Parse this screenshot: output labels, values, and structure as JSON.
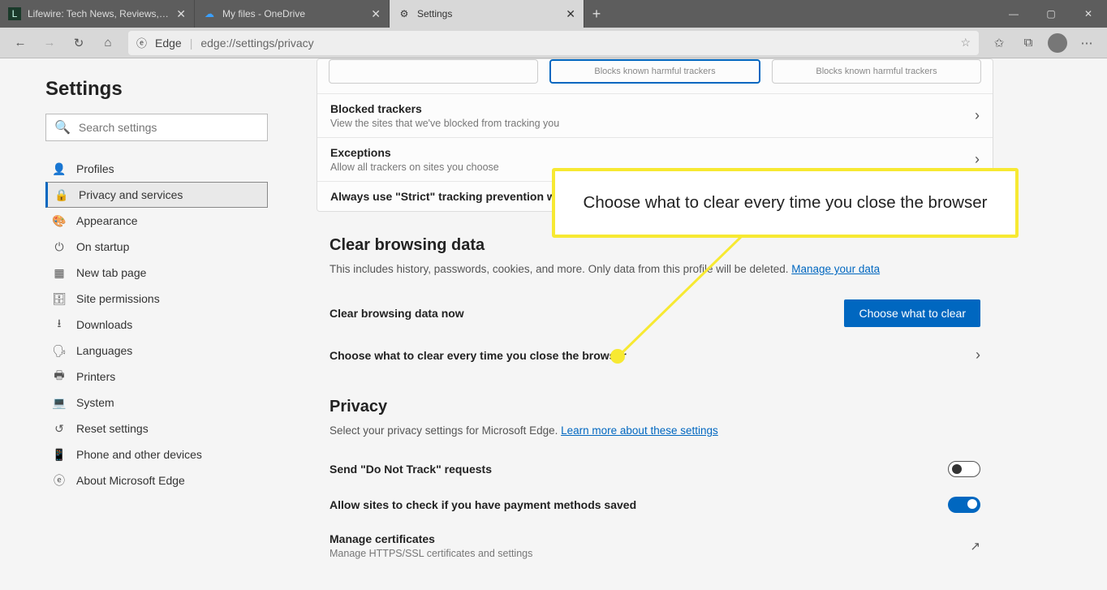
{
  "tabs": [
    {
      "label": "Lifewire: Tech News, Reviews, He",
      "favicon": "L"
    },
    {
      "label": "My files - OneDrive",
      "favicon": "☁"
    },
    {
      "label": "Settings",
      "favicon": "⚙"
    }
  ],
  "window": {
    "minimize": "—",
    "maximize": "▢",
    "close": "✕"
  },
  "newtab": "+",
  "toolbar": {
    "edge_label": "Edge",
    "url": "edge://settings/privacy"
  },
  "sidebar": {
    "heading": "Settings",
    "search_placeholder": "Search settings",
    "items": [
      {
        "icon": "👤",
        "label": "Profiles"
      },
      {
        "icon": "🔒",
        "label": "Privacy and services"
      },
      {
        "icon": "🎨",
        "label": "Appearance"
      },
      {
        "icon": "⏻",
        "label": "On startup"
      },
      {
        "icon": "▦",
        "label": "New tab page"
      },
      {
        "icon": "🗄",
        "label": "Site permissions"
      },
      {
        "icon": "⭳",
        "label": "Downloads"
      },
      {
        "icon": "🗣",
        "label": "Languages"
      },
      {
        "icon": "🖶",
        "label": "Printers"
      },
      {
        "icon": "💻",
        "label": "System"
      },
      {
        "icon": "↺",
        "label": "Reset settings"
      },
      {
        "icon": "📱",
        "label": "Phone and other devices"
      },
      {
        "icon": "ⓔ",
        "label": "About Microsoft Edge"
      }
    ]
  },
  "tracking": {
    "box_text": "Blocks known harmful trackers",
    "blocked": {
      "title": "Blocked trackers",
      "sub": "View the sites that we've blocked from tracking you"
    },
    "exceptions": {
      "title": "Exceptions",
      "sub": "Allow all trackers on sites you choose"
    },
    "always_strict": "Always use \"Strict\" tracking prevention whe"
  },
  "clear": {
    "heading": "Clear browsing data",
    "desc_pre": "This includes history, passwords, cookies, and more. Only data from this profile will be deleted. ",
    "desc_link": "Manage your data",
    "now": "Clear browsing data now",
    "button": "Choose what to clear",
    "every_close": "Choose what to clear every time you close the browser"
  },
  "privacy": {
    "heading": "Privacy",
    "desc_pre": "Select your privacy settings for Microsoft Edge. ",
    "desc_link": "Learn more about these settings",
    "dnt": "Send \"Do Not Track\" requests",
    "payment": "Allow sites to check if you have payment methods saved",
    "certs": {
      "title": "Manage certificates",
      "sub": "Manage HTTPS/SSL certificates and settings"
    }
  },
  "callout": "Choose what to clear every time you close the browser"
}
